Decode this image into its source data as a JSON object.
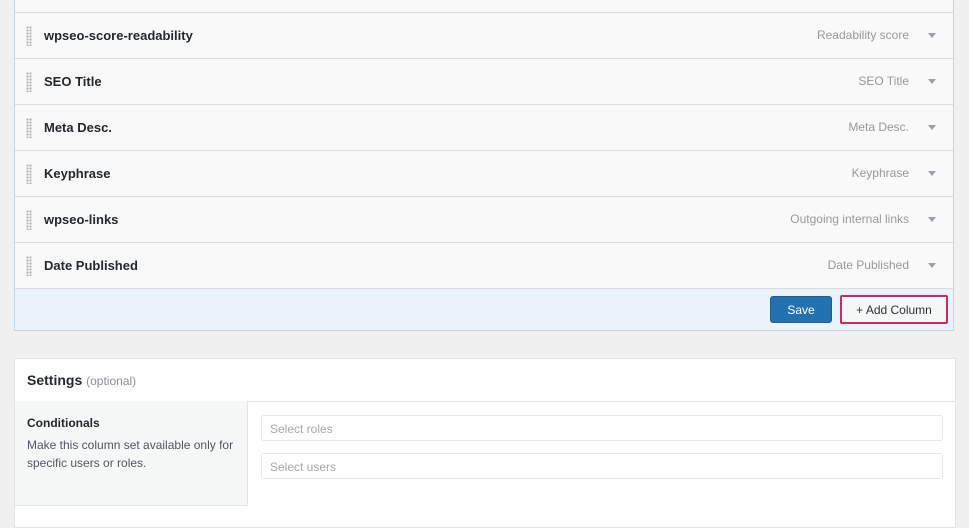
{
  "columns": [
    {
      "name": "wpseo-score-readability",
      "type": "Readability score"
    },
    {
      "name": "SEO Title",
      "type": "SEO Title"
    },
    {
      "name": "Meta Desc.",
      "type": "Meta Desc."
    },
    {
      "name": "Keyphrase",
      "type": "Keyphrase"
    },
    {
      "name": "wpseo-links",
      "type": "Outgoing internal links"
    },
    {
      "name": "Date Published",
      "type": "Date Published"
    }
  ],
  "footer": {
    "save_label": "Save",
    "add_column_label": "+ Add Column"
  },
  "settings": {
    "title": "Settings",
    "optional": "(optional)",
    "conditionals": {
      "label": "Conditionals",
      "description": "Make this column set available only for specific users or roles.",
      "roles_placeholder": "Select roles",
      "users_placeholder": "Select users"
    }
  },
  "colors": {
    "primary_button": "#2271b1",
    "highlight_border": "#d6255f",
    "footer_bg": "#eaf2fa"
  }
}
